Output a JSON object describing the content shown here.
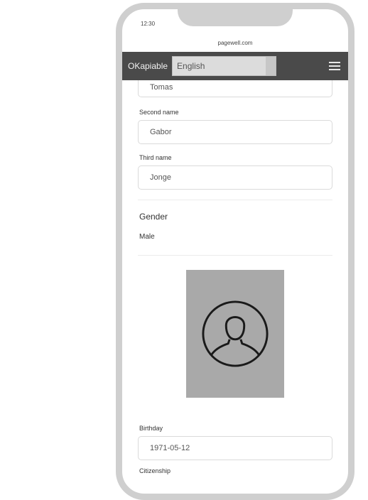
{
  "status": {
    "time": "12:30"
  },
  "browser": {
    "url": "pagewell.com"
  },
  "appbar": {
    "brand": "OKapiable",
    "language": "English",
    "menu_icon": "hamburger-menu-icon"
  },
  "form": {
    "first_name_value": "Tomas",
    "second_name_label": "Second name",
    "second_name_value": "Gabor",
    "third_name_label": "Third name",
    "third_name_value": "Jonge",
    "gender_title": "Gender",
    "gender_value": "Male",
    "photo_icon": "user-avatar-icon",
    "birthday_label": "Birthday",
    "birthday_value": "1971-05-12",
    "next_label": "Citizenship"
  }
}
